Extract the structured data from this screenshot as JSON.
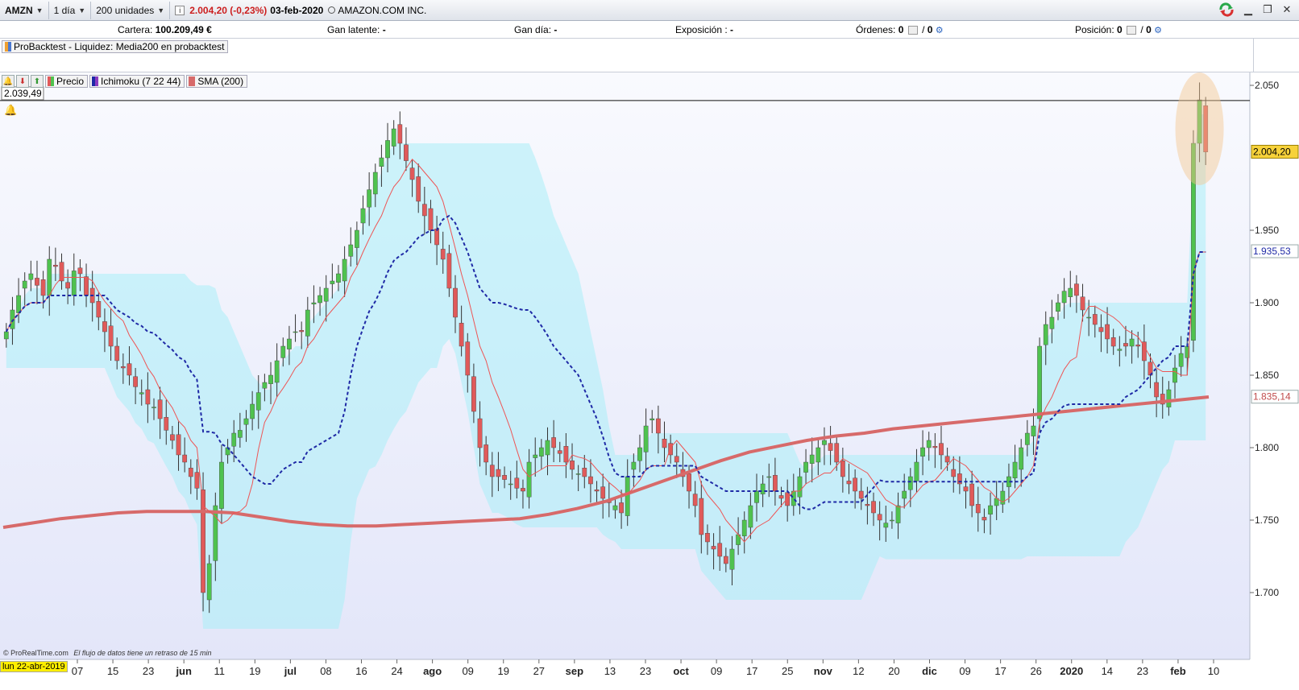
{
  "toolbar": {
    "symbol": "AMZN",
    "period": "1 día",
    "units": "200 unidades",
    "price": "2.004,20 (-0,23%)",
    "date": "03-feb-2020",
    "company": "AMAZON.COM INC."
  },
  "account": {
    "cartera_label": "Cartera:",
    "cartera_value": "100.209,49 €",
    "gan_latente_label": "Gan latente:",
    "gan_latente_value": "-",
    "gan_dia_label": "Gan día:",
    "gan_dia_value": "-",
    "exposicion_label": "Exposición :",
    "exposicion_value": "-",
    "ordenes_label": "Órdenes:",
    "ordenes_value_a": "0",
    "ordenes_value_b": "0",
    "posicion_label": "Posición:",
    "posicion_value_a": "0",
    "posicion_value_b": "0"
  },
  "indicator_panel": {
    "label": "ProBacktest - Liquidez: Media200 en probacktest"
  },
  "legend": {
    "price": "Precio",
    "ichimoku": "Ichimoku (7 22 44)",
    "sma": "SMA (200)"
  },
  "footer": {
    "source": "© ProRealTime.com",
    "delay_note": "El flujo de datos tiene un retraso de 15 min",
    "cursor_date": "lun 22-abr-2019"
  },
  "colors": {
    "up": "#4fc24f",
    "down": "#e05a5a",
    "sma": "#d76a6a",
    "tenkan": "#ee5555",
    "kijun": "#1f2aa6",
    "cloud_blue": "#a9eef8",
    "cloud_green": "#bdeec5",
    "highlight": "#f5c58e",
    "alert_line": "#111111"
  },
  "chart_data": {
    "type": "candlestick",
    "y_ticks": [
      "2.050",
      "1.950",
      "1.900",
      "1.850",
      "1.800",
      "1.750",
      "1.700"
    ],
    "ylim": [
      1665,
      2070
    ],
    "x_ticks": [
      "07",
      "15",
      "23",
      "jun",
      "11",
      "19",
      "jul",
      "08",
      "16",
      "24",
      "ago",
      "09",
      "19",
      "27",
      "sep",
      "13",
      "23",
      "oct",
      "09",
      "17",
      "25",
      "nov",
      "12",
      "20",
      "dic",
      "09",
      "17",
      "26",
      "2020",
      "14",
      "23",
      "feb",
      "10"
    ],
    "price_labels": {
      "alert": "2.039,49",
      "last": "2.004,20",
      "kijun": "1.935,53",
      "sma": "1.835,14"
    },
    "alert_level": 2039.49,
    "close_series": [
      1880,
      1895,
      1905,
      1915,
      1920,
      1912,
      1905,
      1930,
      1925,
      1915,
      1910,
      1922,
      1920,
      1905,
      1900,
      1890,
      1880,
      1870,
      1860,
      1855,
      1850,
      1842,
      1838,
      1830,
      1828,
      1820,
      1812,
      1805,
      1795,
      1790,
      1780,
      1772,
      1700,
      1720,
      1760,
      1790,
      1800,
      1810,
      1812,
      1820,
      1830,
      1838,
      1845,
      1850,
      1860,
      1870,
      1875,
      1880,
      1880,
      1895,
      1900,
      1905,
      1910,
      1915,
      1920,
      1930,
      1940,
      1950,
      1965,
      1978,
      1990,
      2000,
      2012,
      2020,
      2010,
      1998,
      1985,
      1970,
      1960,
      1950,
      1940,
      1930,
      1910,
      1890,
      1870,
      1850,
      1825,
      1800,
      1790,
      1780,
      1780,
      1778,
      1775,
      1772,
      1770,
      1790,
      1795,
      1800,
      1805,
      1800,
      1796,
      1790,
      1785,
      1782,
      1780,
      1775,
      1770,
      1765,
      1762,
      1760,
      1755,
      1780,
      1790,
      1800,
      1815,
      1820,
      1810,
      1800,
      1795,
      1790,
      1780,
      1770,
      1760,
      1740,
      1735,
      1730,
      1725,
      1720,
      1730,
      1740,
      1750,
      1760,
      1770,
      1775,
      1780,
      1770,
      1765,
      1760,
      1770,
      1780,
      1790,
      1795,
      1800,
      1805,
      1798,
      1790,
      1780,
      1775,
      1770,
      1765,
      1760,
      1755,
      1750,
      1748,
      1750,
      1760,
      1770,
      1780,
      1790,
      1800,
      1805,
      1800,
      1795,
      1790,
      1780,
      1775,
      1770,
      1760,
      1755,
      1750,
      1760,
      1765,
      1770,
      1780,
      1790,
      1800,
      1810,
      1815,
      1870,
      1885,
      1890,
      1900,
      1908,
      1910,
      1905,
      1895,
      1890,
      1885,
      1880,
      1875,
      1870,
      1868,
      1870,
      1875,
      1870,
      1860,
      1850,
      1835,
      1830,
      1840,
      1855,
      1865,
      1870,
      2010,
      2040,
      2004
    ],
    "sma_series": [
      1745,
      1748,
      1751,
      1753,
      1755,
      1756,
      1756,
      1756,
      1755,
      1752,
      1749,
      1747,
      1746,
      1746,
      1747,
      1748,
      1749,
      1750,
      1751,
      1754,
      1758,
      1763,
      1770,
      1777,
      1784,
      1791,
      1797,
      1801,
      1805,
      1808,
      1810,
      1813,
      1815,
      1817,
      1819,
      1821,
      1823,
      1825,
      1827,
      1829,
      1831,
      1833,
      1835
    ]
  }
}
